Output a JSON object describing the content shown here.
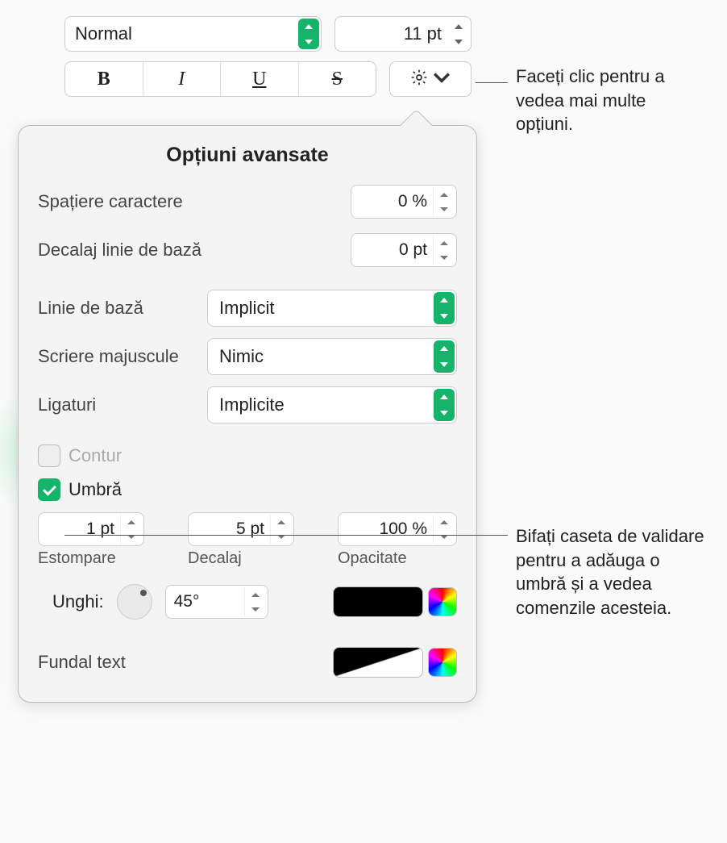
{
  "toolbar": {
    "font_weight_value": "Normal",
    "font_size_value": "11 pt"
  },
  "callouts": {
    "gear": "Faceți clic pentru a vedea mai multe opțiuni.",
    "shadow": "Bifați caseta de validare pentru a adăuga o umbră și a vedea comenzile acesteia."
  },
  "popover": {
    "title": "Opțiuni avansate",
    "char_spacing_label": "Spațiere caractere",
    "char_spacing_value": "0 %",
    "baseline_shift_label": "Decalaj linie de bază",
    "baseline_shift_value": "0 pt",
    "baseline_label": "Linie de bază",
    "baseline_value": "Implicit",
    "caps_label": "Scriere majuscule",
    "caps_value": "Nimic",
    "ligatures_label": "Ligaturi",
    "ligatures_value": "Implicite",
    "outline_label": "Contur",
    "shadow_label": "Umbră",
    "shadow": {
      "blur_value": "1 pt",
      "blur_caption": "Estompare",
      "offset_value": "5 pt",
      "offset_caption": "Decalaj",
      "opacity_value": "100 %",
      "opacity_caption": "Opacitate",
      "angle_label": "Unghi:",
      "angle_value": "45°"
    },
    "text_bg_label": "Fundal text"
  }
}
